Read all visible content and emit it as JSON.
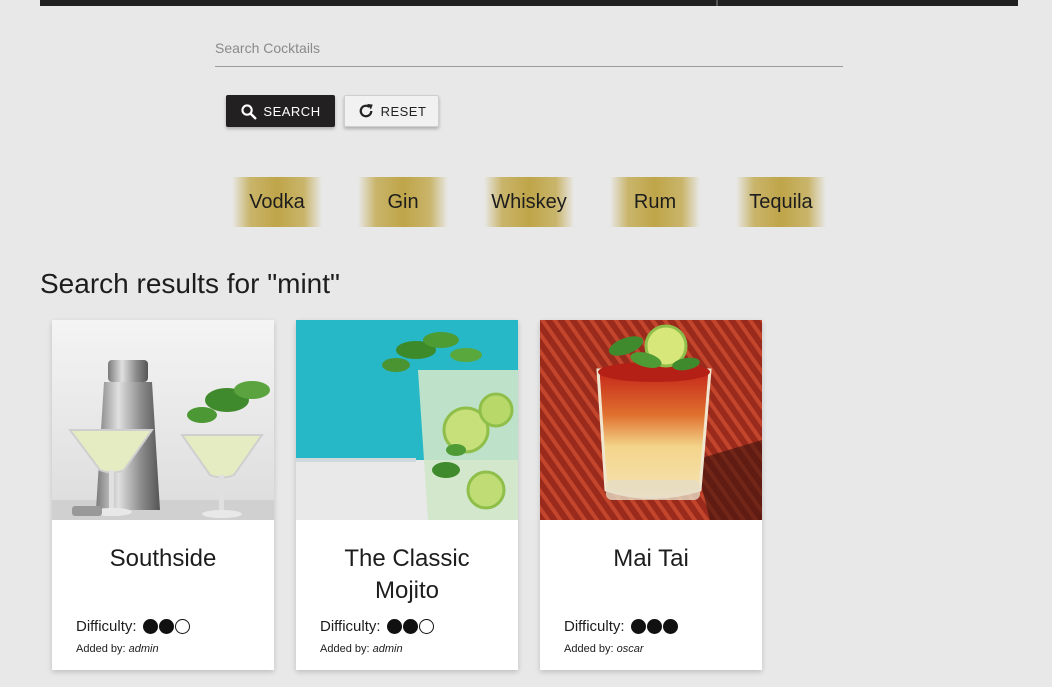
{
  "search": {
    "placeholder": "Search Cocktails",
    "value": ""
  },
  "buttons": {
    "search_label": "SEARCH",
    "reset_label": "RESET"
  },
  "spirits": [
    "Vodka",
    "Gin",
    "Whiskey",
    "Rum",
    "Tequila"
  ],
  "results_title": "Search results for \"mint\"",
  "cards": [
    {
      "name": "Southside",
      "difficulty_label": "Difficulty:",
      "difficulty": 2,
      "difficulty_max": 3,
      "added_by_label": "Added by:",
      "added_by": "admin",
      "image": "southside-photo"
    },
    {
      "name": "The Classic Mojito",
      "difficulty_label": "Difficulty:",
      "difficulty": 2,
      "difficulty_max": 3,
      "added_by_label": "Added by:",
      "added_by": "admin",
      "image": "mojito-photo"
    },
    {
      "name": "Mai Tai",
      "difficulty_label": "Difficulty:",
      "difficulty": 3,
      "difficulty_max": 3,
      "added_by_label": "Added by:",
      "added_by": "oscar",
      "image": "mai-tai-photo"
    }
  ],
  "icons": {
    "search": "search-icon",
    "reset": "refresh-icon"
  },
  "colors": {
    "search_button": "#232021",
    "spirit_gold": "#bfa549",
    "background": "#e8e8e8"
  }
}
